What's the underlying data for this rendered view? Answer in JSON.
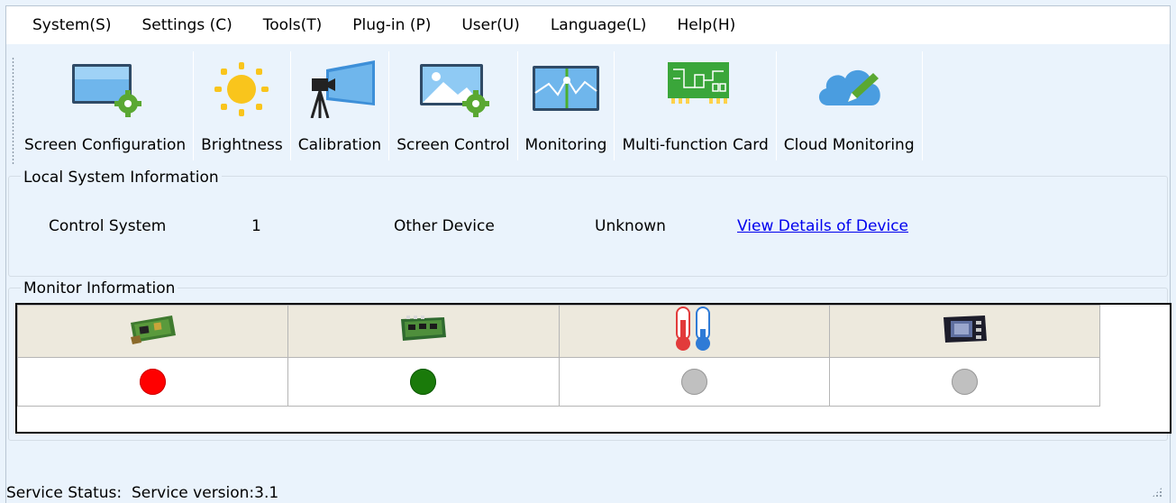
{
  "menubar": {
    "items": [
      {
        "label": "System(S)"
      },
      {
        "label": "Settings (C)"
      },
      {
        "label": "Tools(T)"
      },
      {
        "label": "Plug-in (P)"
      },
      {
        "label": "User(U)"
      },
      {
        "label": "Language(L)"
      },
      {
        "label": "Help(H)"
      }
    ]
  },
  "toolbar": {
    "items": [
      {
        "label": "Screen Configuration",
        "icon": "screen-config-icon"
      },
      {
        "label": "Brightness",
        "icon": "sun-icon"
      },
      {
        "label": "Calibration",
        "icon": "camera-tripod-icon"
      },
      {
        "label": "Screen Control",
        "icon": "screen-control-icon"
      },
      {
        "label": "Monitoring",
        "icon": "monitor-wave-icon"
      },
      {
        "label": "Multi-function Card",
        "icon": "circuit-board-icon"
      },
      {
        "label": "Cloud Monitoring",
        "icon": "cloud-edit-icon"
      }
    ]
  },
  "local_info": {
    "title": "Local System Information",
    "control_system_label": "Control System",
    "control_system_value": "1",
    "other_device_label": "Other Device",
    "other_device_value": "Unknown",
    "details_link": "View Details of Device"
  },
  "monitor_info": {
    "title": "Monitor Information",
    "columns": [
      {
        "icon": "sending-card-icon",
        "status_color": "#ff0000"
      },
      {
        "icon": "receiving-card-icon",
        "status_color": "#1a7a0a"
      },
      {
        "icon": "thermometer-icon",
        "status_color": "#c0c0c0"
      },
      {
        "icon": "chip-module-icon",
        "status_color": "#c0c0c0"
      }
    ]
  },
  "status_bar": {
    "text": "Service Status:  Service version:3.1"
  },
  "colors": {
    "background": "#eaf3fc",
    "link": "#0000ee",
    "status_error": "#ff0000",
    "status_ok": "#1a7a0a",
    "status_unknown": "#c0c0c0"
  }
}
